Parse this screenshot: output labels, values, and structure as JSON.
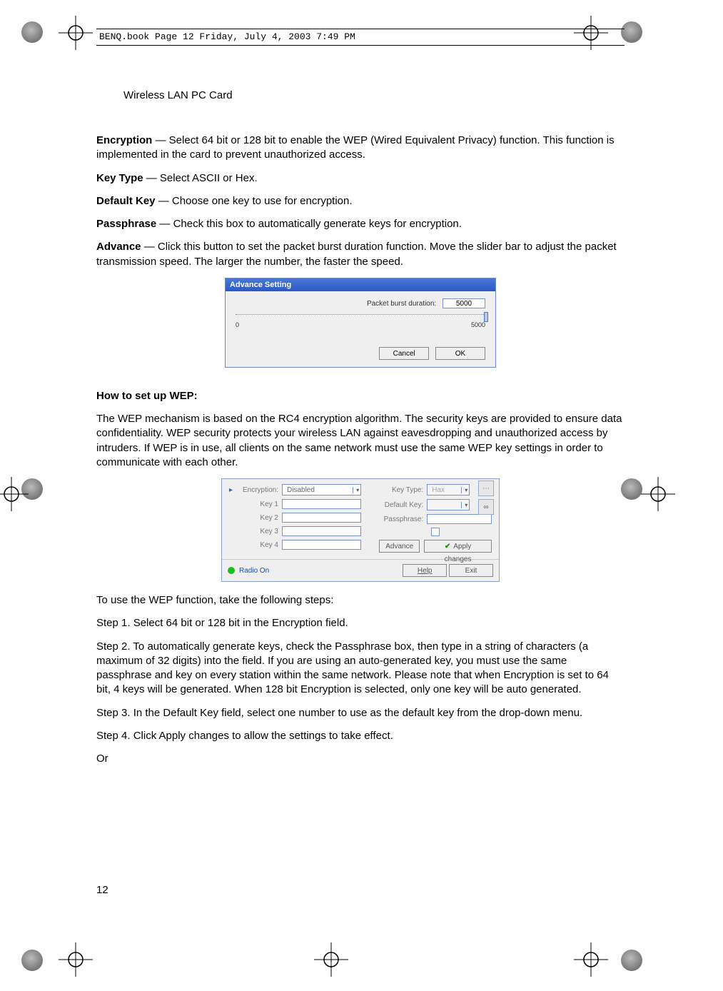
{
  "header": {
    "book_stamp": "BENQ.book  Page 12  Friday, July 4, 2003  7:49 PM"
  },
  "running_head": "Wireless LAN PC Card",
  "page_number": "12",
  "para": {
    "encryption_label": "Encryption",
    "encryption_text": " — Select 64 bit or 128 bit to enable the WEP (Wired Equivalent Privacy) function. This function is implemented in the card to prevent unauthorized access.",
    "keytype_label": "Key Type",
    "keytype_text": " — Select ASCII or Hex.",
    "defaultkey_label": "Default Key",
    "defaultkey_text": " — Choose one key to use for encryption.",
    "passphrase_label": "Passphrase",
    "passphrase_text": " — Check this box to automatically generate keys for encryption.",
    "advance_label": "Advance",
    "advance_text": " — Click this button to set the packet burst duration function. Move the slider bar to adjust the packet transmission speed. The larger the number, the faster the speed.",
    "wep_heading": "How to set up WEP:",
    "wep_intro": "The WEP mechanism is based on the RC4 encryption algorithm. The security keys are provided to ensure data confidentiality. WEP security protects your wireless LAN against eavesdropping and unauthorized access by intruders. If WEP is in use, all clients on the same network must use the same WEP key settings in order to communicate with each other.",
    "wep_lead": "To use the WEP function, take the following steps:",
    "step1": "Step 1. Select 64 bit or 128 bit in the Encryption field.",
    "step2": "Step 2. To automatically generate keys, check the Passphrase box, then type in a string of characters (a maximum of 32 digits) into the field. If you are using an auto-generated key, you must use the same passphrase and key on every station within the same network. Please note that when Encryption is set to 64 bit, 4 keys will be generated. When 128 bit Encryption is selected, only one key will be auto generated.",
    "step3": "Step 3. In the Default Key field, select one number to use as the default key from the drop-down menu.",
    "step4": "Step 4. Click Apply changes to allow the settings to take effect.",
    "or": "Or"
  },
  "fig1": {
    "title": "Advance Setting",
    "label": "Packet burst duration:",
    "value": "5000",
    "min": "0",
    "max": "5000",
    "cancel": "Cancel",
    "ok": "OK"
  },
  "fig2": {
    "encryption_label": "Encryption:",
    "encryption_value": "Disabled",
    "key1": "Key 1",
    "key2": "Key 2",
    "key3": "Key 3",
    "key4": "Key 4",
    "keytype_label": "Key Type:",
    "keytype_value": "Hax",
    "defaultkey_label": "Default Key:",
    "passphrase_label": "Passphrase:",
    "advance_btn": "Advance",
    "apply_btn": "Apply changes",
    "radio": "Radio On",
    "help": "Help",
    "exit": "Exit"
  }
}
